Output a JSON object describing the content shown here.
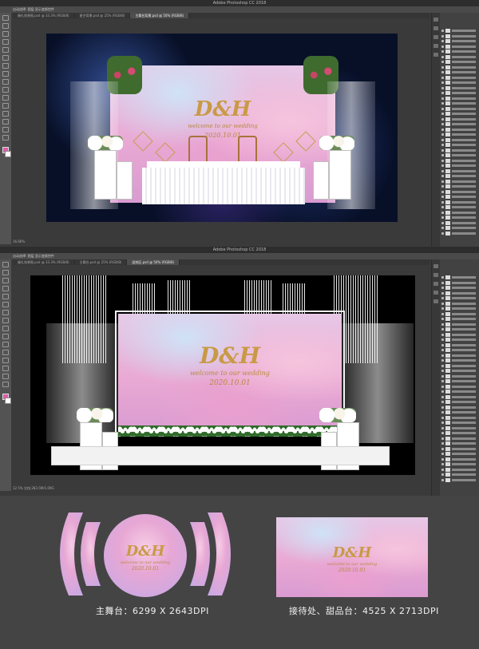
{
  "app": {
    "title": "Adobe Photoshop CC 2018",
    "options_bar_text": "自动选择: 图层 显示变换控件"
  },
  "window1": {
    "tabs": [
      "婚礼效果图.psd @ 33.3% (RGB/8)",
      "星空背景.psd @ 25% (RGB/8)",
      "主舞台背景.psd @ 50% (RGB/8)"
    ],
    "active_tab": 2,
    "status": "16.66%"
  },
  "window2": {
    "tabs": [
      "婚礼效果图.psd @ 33.3% (RGB/8)",
      "主舞台.psd @ 25% (RGB/8)",
      "迎宾区.psd @ 50% (RGB/8)"
    ],
    "active_tab": 2,
    "status": "12.5%  文档:283.5M/1.09G"
  },
  "backdrop": {
    "monogram": "D&H",
    "welcome": "welcome to our wedding",
    "date": "2020.10.01"
  },
  "captions": {
    "main_stage": "主舞台：6299 X 2643DPI",
    "reception": "接待处、甜品台：4525 X 2713DPI"
  },
  "colors": {
    "accent_pink": "#e9a9d4",
    "gold": "#c99a46",
    "ps_bg": "#3a3a3a",
    "page_bg": "#444444"
  },
  "icons": {
    "tool_icons": [
      "move-icon",
      "marquee-icon",
      "lasso-icon",
      "crop-icon",
      "eyedropper-icon",
      "brush-icon",
      "stamp-icon",
      "eraser-icon",
      "gradient-icon",
      "dodge-icon",
      "pen-icon",
      "type-icon",
      "path-select-icon",
      "shape-icon",
      "hand-icon",
      "zoom-icon"
    ]
  }
}
